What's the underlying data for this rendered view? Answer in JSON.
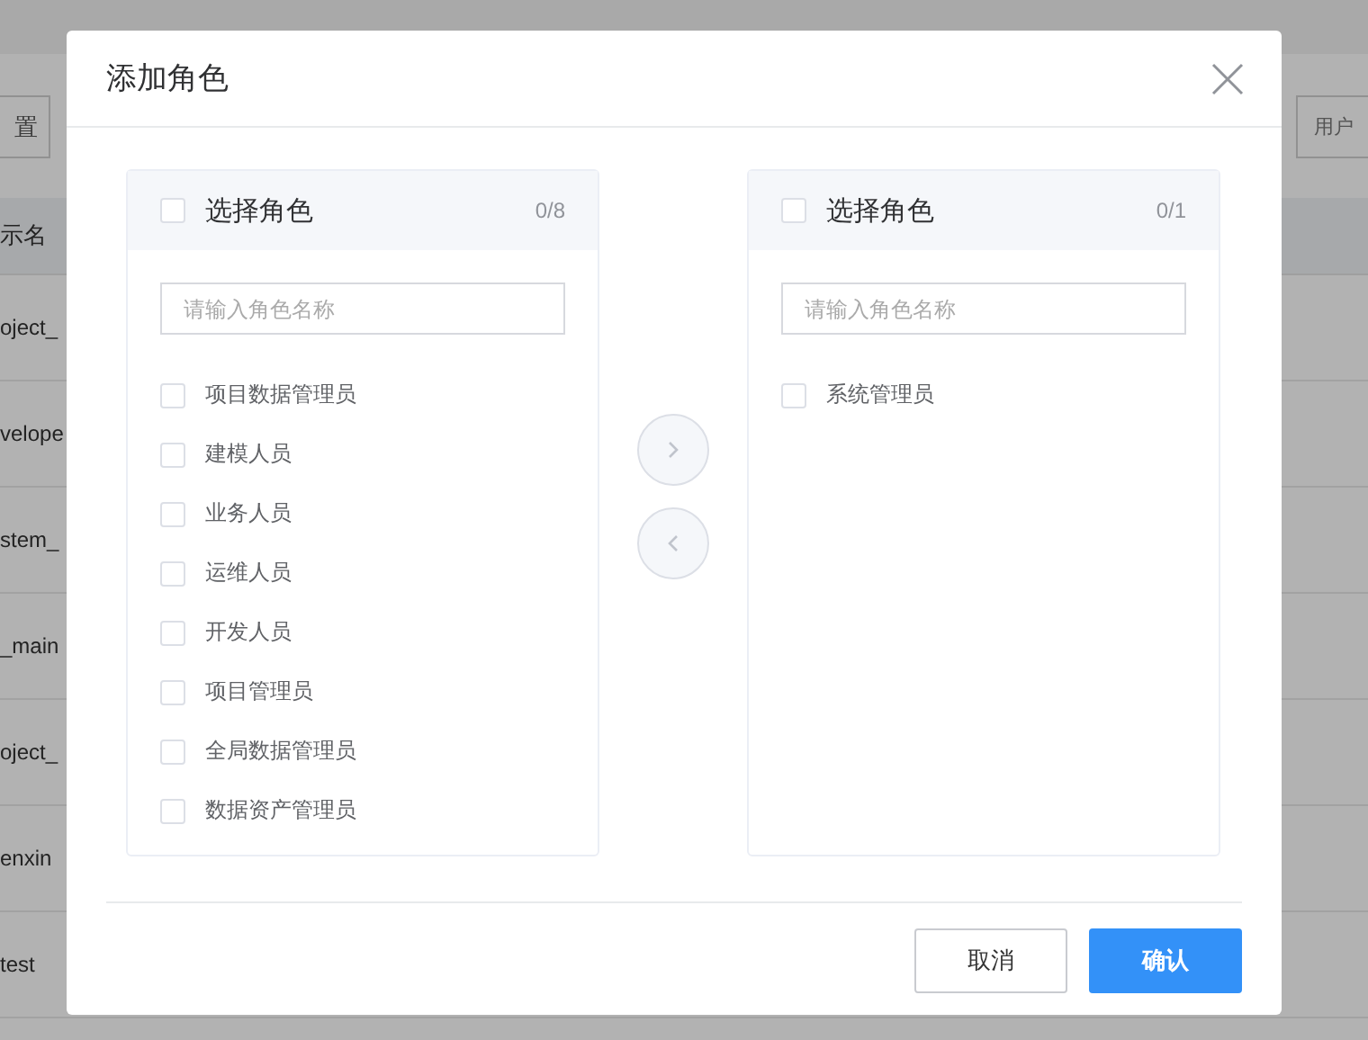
{
  "background_page": {
    "toolbar_button": "置",
    "search_field": {
      "placeholder": "用户"
    },
    "table": {
      "column_header": "示名",
      "rows": [
        "oject_",
        "velope",
        "stem_",
        "_main",
        "oject_",
        "enxin",
        "test"
      ]
    }
  },
  "dialog": {
    "title": "添加角色",
    "panels": [
      {
        "title": "选择角色",
        "count": "0/8",
        "all_checked": false,
        "search": {
          "placeholder": "请输入角色名称"
        },
        "items": [
          {
            "label": "项目数据管理员",
            "checked": false
          },
          {
            "label": "建模人员",
            "checked": false
          },
          {
            "label": "业务人员",
            "checked": false
          },
          {
            "label": "运维人员",
            "checked": false
          },
          {
            "label": "开发人员",
            "checked": false
          },
          {
            "label": "项目管理员",
            "checked": false
          },
          {
            "label": "全局数据管理员",
            "checked": false
          },
          {
            "label": "数据资产管理员",
            "checked": false
          }
        ]
      },
      {
        "title": "选择角色",
        "count": "0/1",
        "all_checked": false,
        "search": {
          "placeholder": "请输入角色名称"
        },
        "items": [
          {
            "label": "系统管理员",
            "checked": false
          }
        ]
      }
    ],
    "transfer_buttons": [
      {
        "kind": "right",
        "disabled": true
      },
      {
        "kind": "left",
        "disabled": true
      }
    ],
    "footer_buttons": [
      {
        "label": "取消",
        "kind": "default"
      },
      {
        "label": "确认",
        "kind": "primary"
      }
    ]
  }
}
